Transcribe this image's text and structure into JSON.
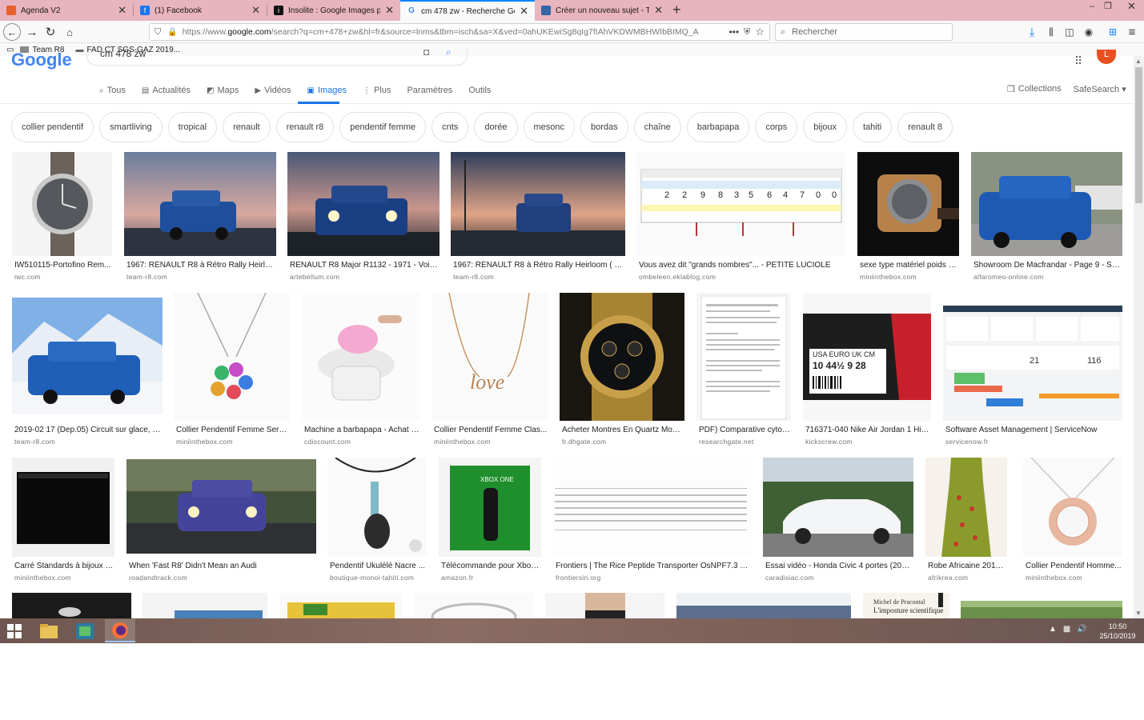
{
  "browser": {
    "tabs": [
      {
        "title": "Agenda V2",
        "color": "#e8612c"
      },
      {
        "title": "(1) Facebook",
        "color": "#1877f2"
      },
      {
        "title": "Insolite : Google Images plus fo",
        "color": "#111111"
      },
      {
        "title": "cm 478 zw - Recherche Google",
        "color": "#4285f4"
      },
      {
        "title": "Créer un nouveau sujet - Team",
        "color": "#3465a4"
      }
    ],
    "url_prefix": "https://www.",
    "url_domain": "google.com",
    "url_rest": "/search?q=cm+478+zw&hl=fr&source=lnms&tbm=isch&sa=X&ved=0ahUKEwiSg8qIg7fIAhVKDWMBHWIbBIMQ_A",
    "search_placeholder": "Rechercher",
    "bookmarks": [
      "Team R8",
      "FAD CT SGS-GAZ 2019..."
    ]
  },
  "google": {
    "logo": "Google",
    "query": "cm 478 zw",
    "nav_tabs": [
      {
        "label": "Tous",
        "icon": "🔍"
      },
      {
        "label": "Actualités",
        "icon": "▤"
      },
      {
        "label": "Maps",
        "icon": "◩"
      },
      {
        "label": "Vidéos",
        "icon": "▶"
      },
      {
        "label": "Images",
        "icon": "▣"
      },
      {
        "label": "Plus",
        "icon": "⋮"
      },
      {
        "label": "Paramètres",
        "icon": ""
      },
      {
        "label": "Outils",
        "icon": ""
      }
    ],
    "collections": "Collections",
    "safesearch": "SafeSearch ▾",
    "avatar_letter": "L",
    "chips": [
      "collier pendentif",
      "smartliving",
      "tropical",
      "renault",
      "renault r8",
      "pendentif femme",
      "cnts",
      "dorée",
      "mesonc",
      "bordas",
      "chaîne",
      "barbapapa",
      "corps",
      "bijoux",
      "tahiti",
      "renault 8"
    ]
  },
  "results": [
    {
      "caption": "IW510115-Portofino Rem...",
      "source": "iwc.com"
    },
    {
      "caption": "1967: RENAULT R8 à Rétro Rally Heirloo...",
      "source": "team-r8.com"
    },
    {
      "caption": "RENAULT R8 Major R1132 - 1971 - Voitur...",
      "source": "artebellum.com"
    },
    {
      "caption": "1967: RENAULT R8 à Rétro Rally Heirloom ( Mo...",
      "source": "team-r8.com"
    },
    {
      "caption": "Vous avez dit \"grands nombres\"... - PETITE LUCIOLE",
      "source": "ombeleen.eklablog.com"
    },
    {
      "caption": "sexe type matériel poids n...",
      "source": "miniinthebox.com"
    },
    {
      "caption": "Showroom De Macfrandar - Page 9 - Sh...",
      "source": "alfaromeo-online.com"
    },
    {
      "caption": "2019-02 17 (Dep.05) Circuit sur glace, O...",
      "source": "team-r8.com"
    },
    {
      "caption": "Collier Pendentif Femme Serp...",
      "source": "miniinthebox.com"
    },
    {
      "caption": "Machine a barbapapa - Achat / ...",
      "source": "cdiscount.com"
    },
    {
      "caption": "Collier Pendentif Femme Clas...",
      "source": "miniinthebox.com"
    },
    {
      "caption": "Acheter Montres En Quartz Montr...",
      "source": "fr.dhgate.com"
    },
    {
      "caption": "PDF) Comparative cytog...",
      "source": "researchgate.net"
    },
    {
      "caption": "716371-040 Nike Air Jordan 1 Hig...",
      "source": "kickscrew.com"
    },
    {
      "caption": "Software Asset Management | ServiceNow",
      "source": "servicenow.fr"
    },
    {
      "caption": "Carré Standards à bijoux - ...",
      "source": "miniinthebox.com"
    },
    {
      "caption": "When 'Fast R8' Didn't Mean an Audi",
      "source": "roadandtrack.com"
    },
    {
      "caption": "Pendentif Ukulélé Nacre ...",
      "source": "boutique-monoi-tahiti.com"
    },
    {
      "caption": "Télécommande pour Xbox ...",
      "source": "amazon.fr"
    },
    {
      "caption": "Frontiers | The Rice Peptide Transporter OsNPF7.3 Is I...",
      "source": "frontiersin.org"
    },
    {
      "caption": "Essai vidéo - Honda Civic 4 portes (2017...",
      "source": "caradisiac.com"
    },
    {
      "caption": "Robe Africaine 2019 | ...",
      "source": "afrikrea.com"
    },
    {
      "caption": "Collier Pendentif Homme...",
      "source": "miniinthebox.com"
    }
  ],
  "thumb_text": {
    "shoe_box": "USA  EURO  UK  CM",
    "shoe_sizes": "10  44½  9  28",
    "xbox": "XBOX ONE",
    "love": "love",
    "book_author": "Michel de Pracontal",
    "book_title": "L'imposture scientifique",
    "nums": [
      "2",
      "2",
      "9",
      "8",
      "3",
      "5",
      "6",
      "4",
      "7",
      "0",
      "0"
    ],
    "dash_a": "21",
    "dash_b": "116"
  },
  "taskbar": {
    "time": "10:50",
    "date": "25/10/2019"
  }
}
